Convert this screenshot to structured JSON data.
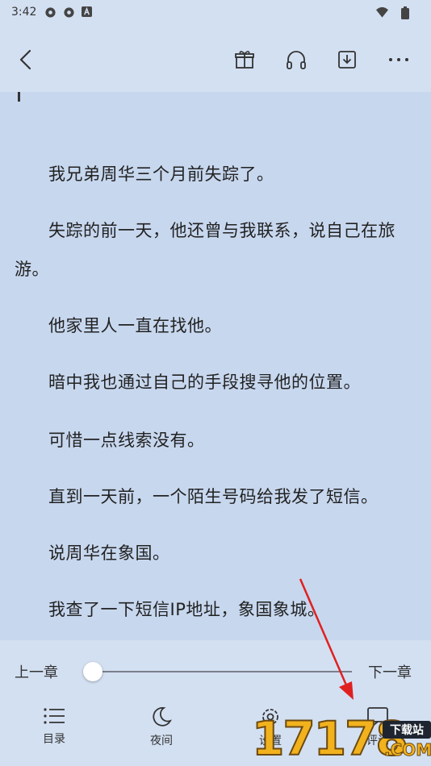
{
  "status_bar": {
    "time": "3:42",
    "icons": [
      "settings-gear-icon",
      "settings-gear-icon",
      "a-badge-icon"
    ],
    "right_icons": [
      "wifi-icon",
      "battery-icon"
    ]
  },
  "toolbar": {
    "icons": [
      "back-chevron-icon",
      "gift-icon",
      "headphones-icon",
      "download-icon",
      "more-dots-icon"
    ]
  },
  "reader": {
    "paragraphs": [
      "我兄弟周华三个月前失踪了。",
      "失踪的前一天，他还曾与我联系，说自己在旅游。",
      "他家里人一直在找他。",
      "暗中我也通过自己的手段搜寻他的位置。",
      "可惜一点线索没有。",
      "直到一天前，一个陌生号码给我发了短信。",
      "说周华在象国。",
      "我查了一下短信IP地址，象国象城。"
    ],
    "para2_line1": "失踪的前一天，他还曾与我联系，说自己在旅",
    "para2_line2": "游。"
  },
  "bottom_bar": {
    "prev_chapter": "上一章",
    "next_chapter": "下一章",
    "progress": 0.0,
    "nav": [
      {
        "label": "目录",
        "icon": "list-icon"
      },
      {
        "label": "夜间",
        "icon": "moon-icon"
      },
      {
        "label": "设置",
        "icon": "gear-icon"
      },
      {
        "label": "评论",
        "icon": "comment-icon"
      }
    ]
  },
  "watermark": {
    "digits": "17178",
    "badge": "下载站",
    "com": ".COM"
  },
  "colors": {
    "page_bg": "#c7d7ee",
    "bar_bg": "#d3e0f2",
    "arrow": "#e02020",
    "watermark_gold": "#f2b21d"
  }
}
